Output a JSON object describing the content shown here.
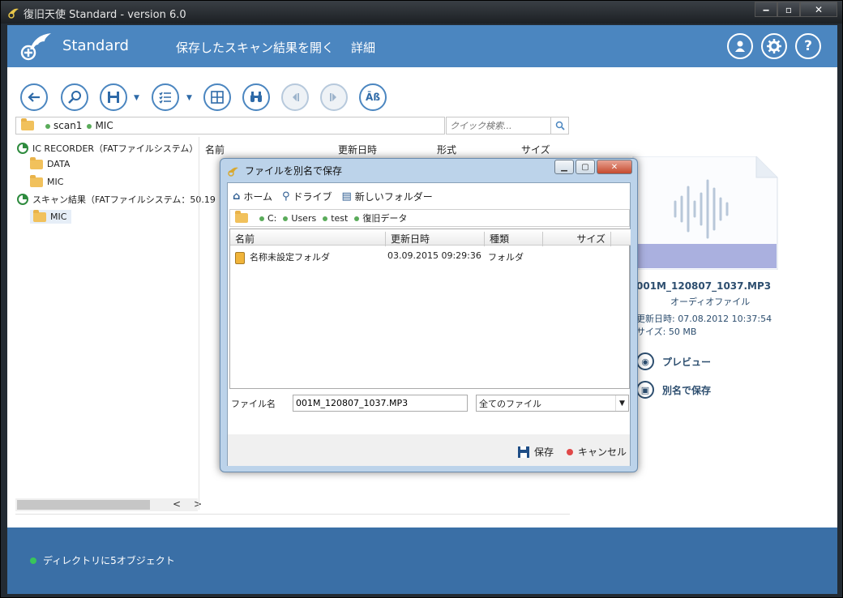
{
  "window": {
    "title": "復旧天使 Standard - version 6.0",
    "min": "‒",
    "max": "▫",
    "close": "✕"
  },
  "header": {
    "brand": "Standard",
    "nav_open": "保存したスキャン結果を開く",
    "nav_details": "詳細"
  },
  "path": {
    "segments": [
      "scan1",
      "MIC"
    ]
  },
  "search": {
    "placeholder": "クイック検索..."
  },
  "tree": {
    "nodes": [
      {
        "label": "IC RECORDER（FATファイルシステム）"
      },
      {
        "label": "DATA"
      },
      {
        "label": "MIC"
      },
      {
        "label": "スキャン結果（FATファイルシステム：50.19"
      },
      {
        "label": "MIC"
      }
    ]
  },
  "list": {
    "headers": {
      "name": "名前",
      "modified": "更新日時",
      "format": "形式",
      "size": "サイズ"
    }
  },
  "preview": {
    "filename": "001M_120807_1037.MP3",
    "type": "オーディオファイル",
    "modified": "更新日時: 07.08.2012 10:37:54",
    "size": "サイズ: 50 MB",
    "action_preview": "プレビュー",
    "action_save": "別名で保存"
  },
  "status": {
    "text": "ディレクトリに5オブジェクト"
  },
  "dialog": {
    "title": "ファイルを別名で保存",
    "toolbar": {
      "home": "ホーム",
      "drive": "ドライブ",
      "new_folder": "新しいフォルダー"
    },
    "path": {
      "segments": [
        "C:",
        "Users",
        "test",
        "復旧データ"
      ]
    },
    "headers": {
      "name": "名前",
      "modified": "更新日時",
      "kind": "種類",
      "size": "サイズ"
    },
    "rows": [
      {
        "name": "名称未設定フォルダ",
        "modified": "03.09.2015 09:29:36",
        "kind": "フォルダ",
        "size": ""
      }
    ],
    "filename_label": "ファイル名",
    "filename_value": "001M_120807_1037.MP3",
    "filetype_value": "全てのファイル",
    "save_label": "保存",
    "cancel_label": "キャンセル"
  },
  "colors": {
    "header": "#4b86c0",
    "status": "#3a6fa6",
    "accent": "#2e6aa8",
    "cancel_dot": "#e04848",
    "status_dot": "#38c55a"
  }
}
